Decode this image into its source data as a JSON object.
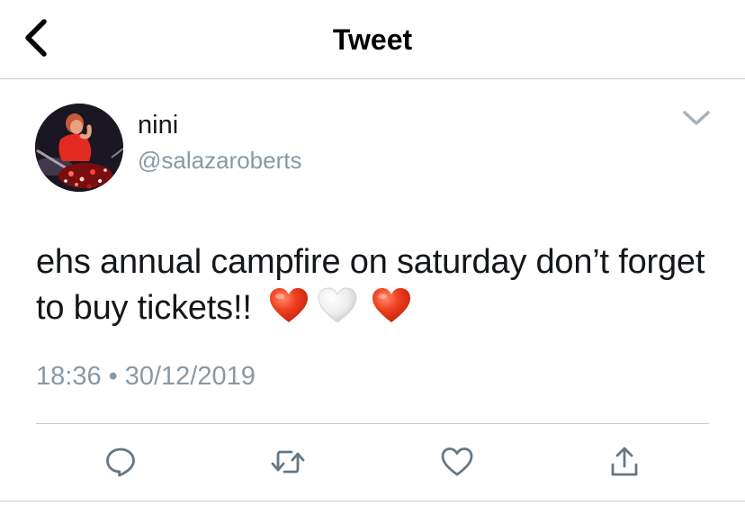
{
  "header": {
    "title": "Tweet",
    "back_icon": "chevron-left-icon"
  },
  "tweet": {
    "author": {
      "display_name": "nini",
      "handle": "@salazaroberts"
    },
    "text": "ehs annual campfire on saturday don’t forget to buy tickets!!",
    "emojis": [
      "red-heart",
      "white-heart",
      "red-heart"
    ],
    "time": "18:36",
    "separator": "•",
    "date": "30/12/2019",
    "more_icon": "chevron-down-icon"
  },
  "actions": [
    {
      "name": "reply",
      "icon": "reply-icon"
    },
    {
      "name": "retweet",
      "icon": "retweet-icon"
    },
    {
      "name": "like",
      "icon": "heart-icon"
    },
    {
      "name": "share",
      "icon": "share-icon"
    }
  ],
  "colors": {
    "text": "#14171a",
    "secondary": "#8899a6",
    "accent": "#1da1f2",
    "divider": "#c8ccd0",
    "heart_red": "#e8391f",
    "heart_white": "#e9e9e9"
  }
}
